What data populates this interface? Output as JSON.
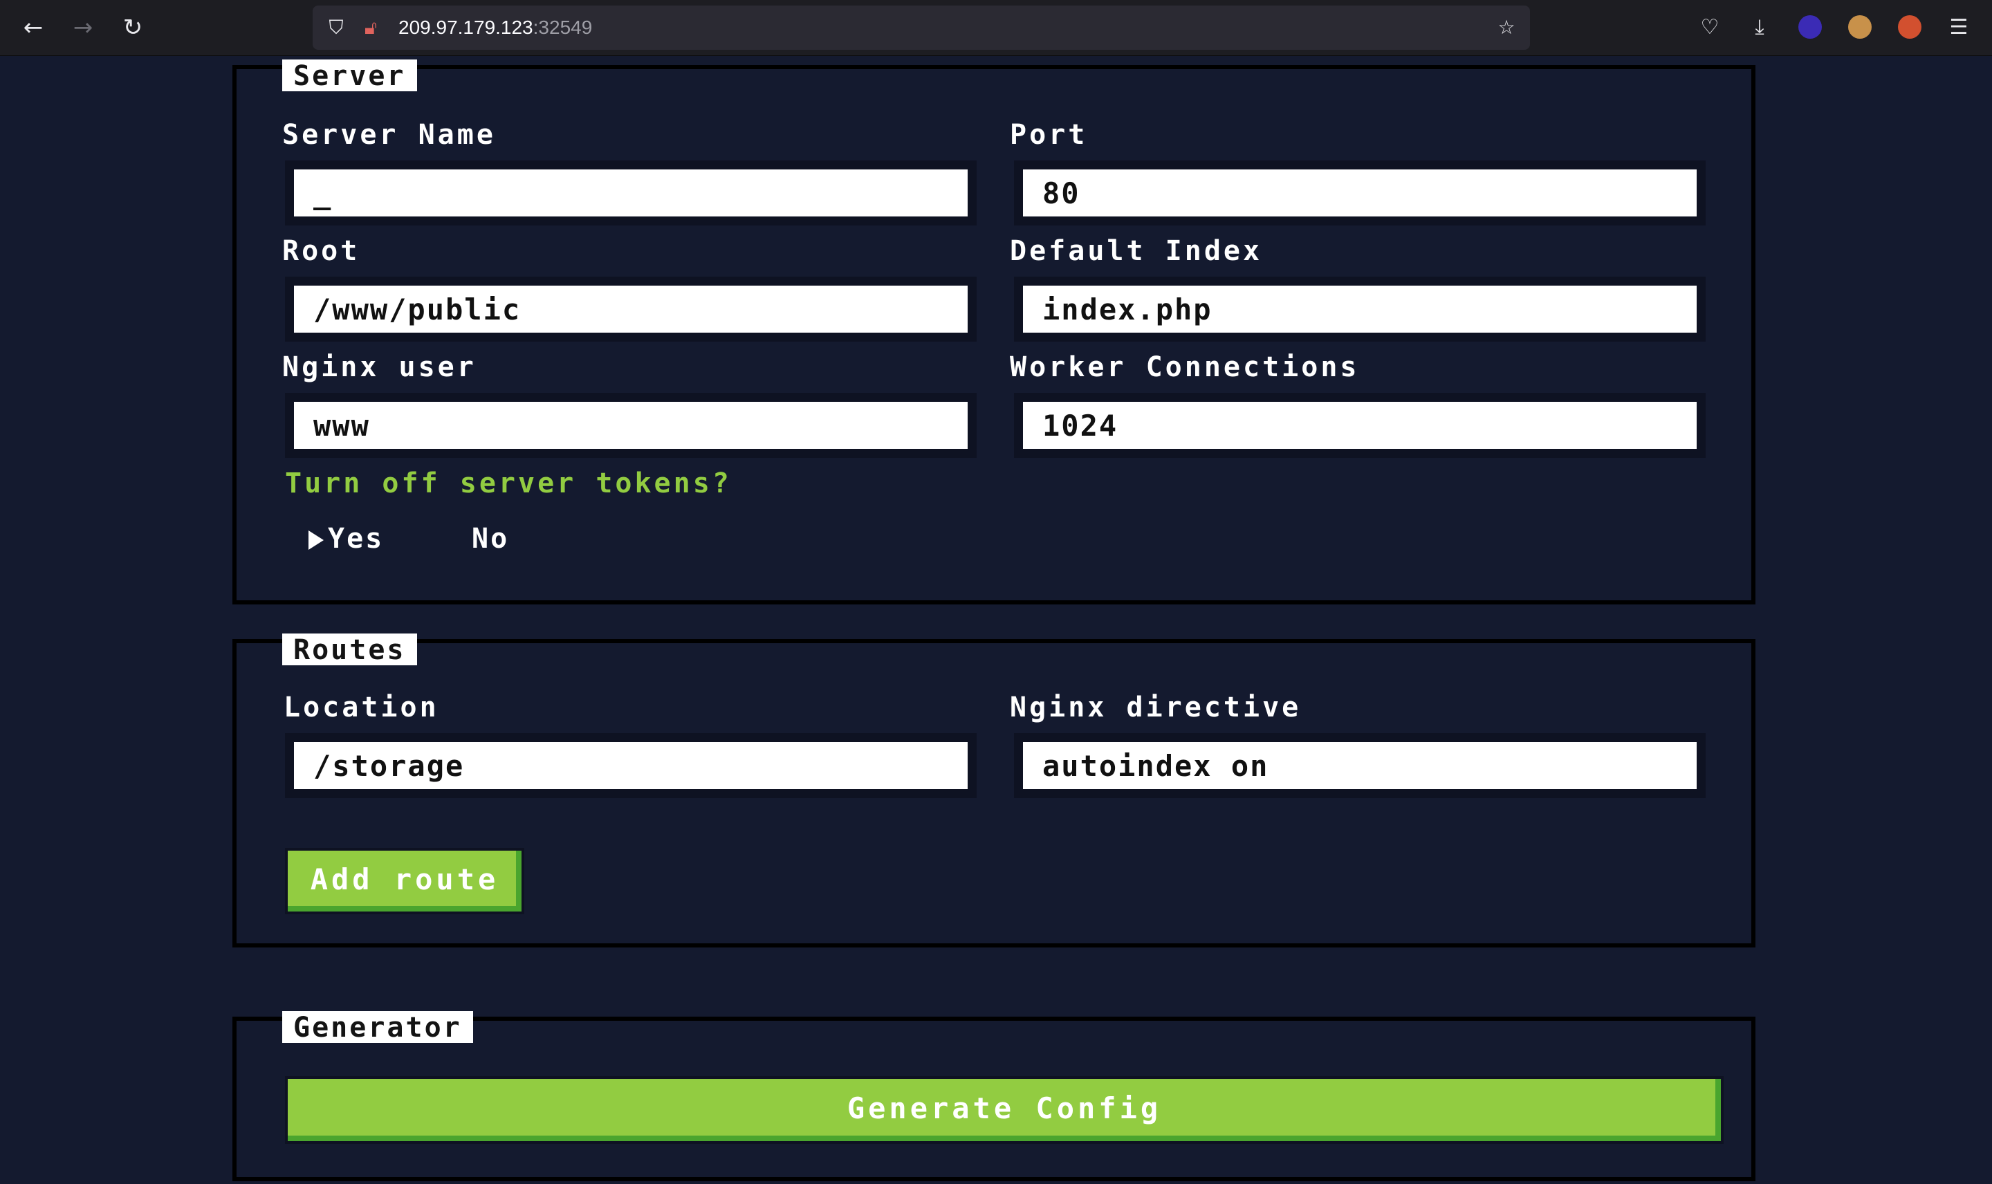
{
  "browser": {
    "url_host": "209.97.179.123",
    "url_port": ":32549",
    "icons": [
      "back-icon",
      "forward-icon",
      "reload-icon",
      "shield-icon",
      "lock-icon",
      "star-icon",
      "pocket-icon",
      "download-icon",
      "extension-icon",
      "cookie-icon",
      "extension-icon-2",
      "menu-icon"
    ]
  },
  "server": {
    "legend": "Server",
    "server_name_label": "Server Name",
    "server_name_value": "_",
    "port_label": "Port",
    "port_value": "80",
    "root_label": "Root",
    "root_value": "/www/public",
    "default_index_label": "Default Index",
    "default_index_value": "index.php",
    "nginx_user_label": "Nginx user",
    "nginx_user_value": "www",
    "worker_connections_label": "Worker Connections",
    "worker_connections_value": "1024",
    "server_tokens_question": "Turn off server tokens?",
    "option_yes": "Yes",
    "option_no": "No"
  },
  "routes": {
    "legend": "Routes",
    "location_label": "Location",
    "location_value": "/storage",
    "directive_label": "Nginx directive",
    "directive_value": "autoindex on",
    "add_route_label": "Add route"
  },
  "generator": {
    "legend": "Generator",
    "generate_label": "Generate Config"
  },
  "colors": {
    "background": "#141a2f",
    "accent_green": "#92cc41",
    "button_shadow": "#4aa52e"
  }
}
